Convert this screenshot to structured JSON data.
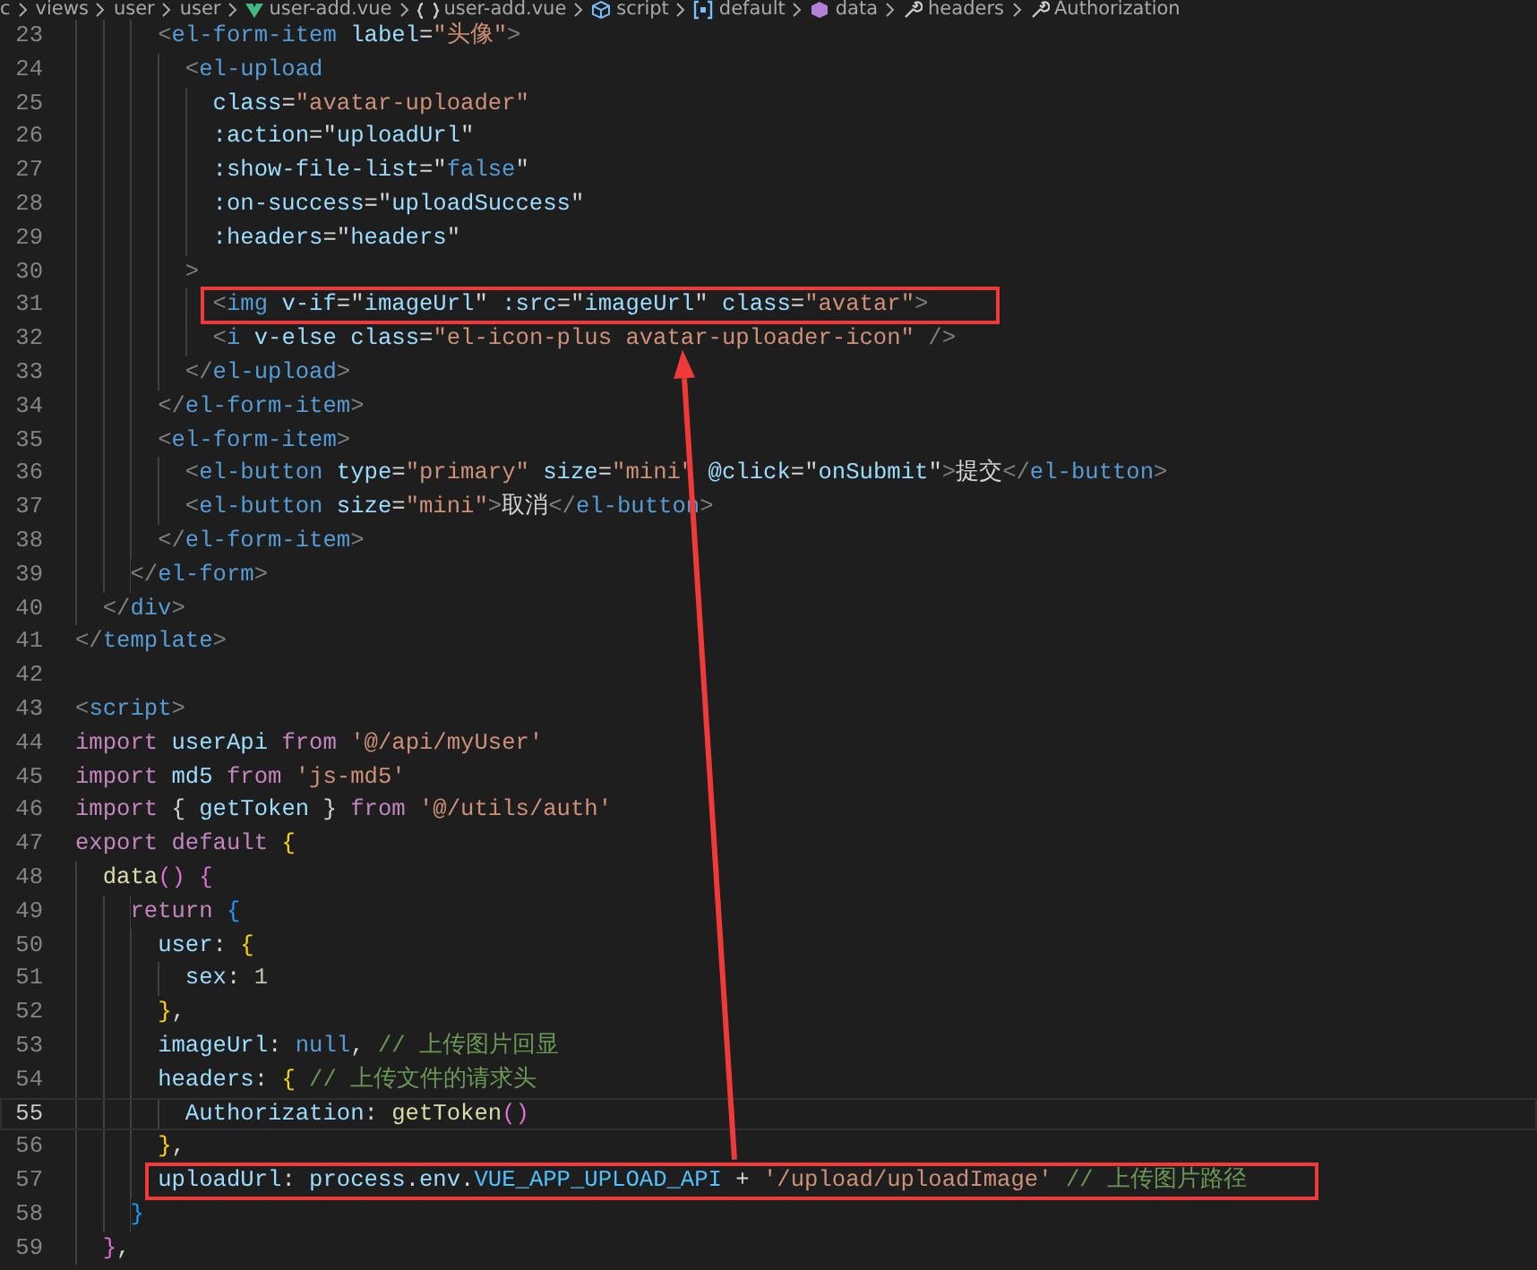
{
  "breadcrumb": [
    {
      "label": "c",
      "kind": "folder"
    },
    {
      "label": "views",
      "kind": "folder"
    },
    {
      "label": "user",
      "kind": "folder"
    },
    {
      "label": "user",
      "kind": "folder"
    },
    {
      "label": "user-add.vue",
      "kind": "vue-file"
    },
    {
      "label": "user-add.vue",
      "kind": "file-symbol"
    },
    {
      "label": "script",
      "kind": "module"
    },
    {
      "label": "default",
      "kind": "object"
    },
    {
      "label": "data",
      "kind": "method"
    },
    {
      "label": "headers",
      "kind": "property"
    },
    {
      "label": "Authorization",
      "kind": "property"
    }
  ],
  "editor": {
    "lines": [
      {
        "children": [
          {
            "children": [
              {
                "children": [
                  {
                    "number": "23",
                    "current": false,
                    "boxed": false,
                    "tokens": [
                      {
                        "kind": "p",
                        "text": "<"
                      },
                      {
                        "kind": "tag",
                        "text": "el-form-item"
                      },
                      {
                        "kind": "attr",
                        "text": " label"
                      },
                      {
                        "kind": "txt",
                        "text": "="
                      },
                      {
                        "kind": "str",
                        "text": "\"头像\""
                      },
                      {
                        "kind": "p",
                        "text": ">"
                      }
                    ],
                    "children": [
                      {
                        "number": "24",
                        "current": false,
                        "boxed": false,
                        "tokens": [
                          {
                            "kind": "p",
                            "text": "<"
                          },
                          {
                            "kind": "tag",
                            "text": "el-upload"
                          }
                        ],
                        "children": [
                          {
                            "number": "25",
                            "current": false,
                            "boxed": false,
                            "tokens": [
                              {
                                "kind": "attr",
                                "text": "class"
                              },
                              {
                                "kind": "txt",
                                "text": "="
                              },
                              {
                                "kind": "str",
                                "text": "\"avatar-uploader\""
                              }
                            ]
                          },
                          {
                            "number": "26",
                            "current": false,
                            "boxed": false,
                            "tokens": [
                              {
                                "kind": "attr",
                                "text": ":action"
                              },
                              {
                                "kind": "txt",
                                "text": "=\""
                              },
                              {
                                "kind": "var",
                                "text": "uploadUrl"
                              },
                              {
                                "kind": "txt",
                                "text": "\""
                              }
                            ]
                          },
                          {
                            "number": "27",
                            "current": false,
                            "boxed": false,
                            "tokens": [
                              {
                                "kind": "attr",
                                "text": ":show-file-list"
                              },
                              {
                                "kind": "txt",
                                "text": "=\""
                              },
                              {
                                "kind": "lit",
                                "text": "false"
                              },
                              {
                                "kind": "txt",
                                "text": "\""
                              }
                            ]
                          },
                          {
                            "number": "28",
                            "current": false,
                            "boxed": false,
                            "tokens": [
                              {
                                "kind": "attr",
                                "text": ":on-success"
                              },
                              {
                                "kind": "txt",
                                "text": "=\""
                              },
                              {
                                "kind": "var",
                                "text": "uploadSuccess"
                              },
                              {
                                "kind": "txt",
                                "text": "\""
                              }
                            ]
                          },
                          {
                            "number": "29",
                            "current": false,
                            "boxed": false,
                            "tokens": [
                              {
                                "kind": "attr",
                                "text": ":headers"
                              },
                              {
                                "kind": "txt",
                                "text": "=\""
                              },
                              {
                                "kind": "var",
                                "text": "headers"
                              },
                              {
                                "kind": "txt",
                                "text": "\""
                              }
                            ]
                          }
                        ]
                      },
                      {
                        "number": "30",
                        "current": false,
                        "boxed": false,
                        "tokens": [
                          {
                            "kind": "p",
                            "text": ">"
                          }
                        ],
                        "children": [
                          {
                            "number": "31",
                            "current": false,
                            "boxed": true,
                            "tokens": [
                              {
                                "kind": "p",
                                "text": "<"
                              },
                              {
                                "kind": "tag",
                                "text": "img"
                              },
                              {
                                "kind": "attr",
                                "text": " v-if"
                              },
                              {
                                "kind": "txt",
                                "text": "=\""
                              },
                              {
                                "kind": "var",
                                "text": "imageUrl"
                              },
                              {
                                "kind": "txt",
                                "text": "\""
                              },
                              {
                                "kind": "attr",
                                "text": " :src"
                              },
                              {
                                "kind": "txt",
                                "text": "=\""
                              },
                              {
                                "kind": "var",
                                "text": "imageUrl"
                              },
                              {
                                "kind": "txt",
                                "text": "\""
                              },
                              {
                                "kind": "attr",
                                "text": " class"
                              },
                              {
                                "kind": "txt",
                                "text": "="
                              },
                              {
                                "kind": "str",
                                "text": "\"avatar\""
                              },
                              {
                                "kind": "p",
                                "text": ">"
                              }
                            ]
                          },
                          {
                            "number": "32",
                            "current": false,
                            "boxed": false,
                            "tokens": [
                              {
                                "kind": "p",
                                "text": "<"
                              },
                              {
                                "kind": "tag",
                                "text": "i"
                              },
                              {
                                "kind": "attr",
                                "text": " v-else"
                              },
                              {
                                "kind": "attr",
                                "text": " class"
                              },
                              {
                                "kind": "txt",
                                "text": "="
                              },
                              {
                                "kind": "str",
                                "text": "\"el-icon-plus avatar-uploader-icon\""
                              },
                              {
                                "kind": "p",
                                "text": " />"
                              }
                            ]
                          }
                        ]
                      },
                      {
                        "number": "33",
                        "current": false,
                        "boxed": false,
                        "tokens": [
                          {
                            "kind": "p",
                            "text": "</"
                          },
                          {
                            "kind": "tag",
                            "text": "el-upload"
                          },
                          {
                            "kind": "p",
                            "text": ">"
                          }
                        ]
                      }
                    ]
                  },
                  {
                    "number": "34",
                    "current": false,
                    "boxed": false,
                    "tokens": [
                      {
                        "kind": "p",
                        "text": "</"
                      },
                      {
                        "kind": "tag",
                        "text": "el-form-item"
                      },
                      {
                        "kind": "p",
                        "text": ">"
                      }
                    ]
                  },
                  {
                    "number": "35",
                    "current": false,
                    "boxed": false,
                    "tokens": [
                      {
                        "kind": "p",
                        "text": "<"
                      },
                      {
                        "kind": "tag",
                        "text": "el-form-item"
                      },
                      {
                        "kind": "p",
                        "text": ">"
                      }
                    ],
                    "children": [
                      {
                        "number": "36",
                        "current": false,
                        "boxed": false,
                        "tokens": [
                          {
                            "kind": "p",
                            "text": "<"
                          },
                          {
                            "kind": "tag",
                            "text": "el-button"
                          },
                          {
                            "kind": "attr",
                            "text": " type"
                          },
                          {
                            "kind": "txt",
                            "text": "="
                          },
                          {
                            "kind": "str",
                            "text": "\"primary\""
                          },
                          {
                            "kind": "attr",
                            "text": " size"
                          },
                          {
                            "kind": "txt",
                            "text": "="
                          },
                          {
                            "kind": "str",
                            "text": "\"mini\""
                          },
                          {
                            "kind": "attr",
                            "text": " @click"
                          },
                          {
                            "kind": "txt",
                            "text": "=\""
                          },
                          {
                            "kind": "var",
                            "text": "onSubmit"
                          },
                          {
                            "kind": "txt",
                            "text": "\""
                          },
                          {
                            "kind": "p",
                            "text": ">"
                          },
                          {
                            "kind": "txt",
                            "text": "提交"
                          },
                          {
                            "kind": "p",
                            "text": "</"
                          },
                          {
                            "kind": "tag",
                            "text": "el-button"
                          },
                          {
                            "kind": "p",
                            "text": ">"
                          }
                        ]
                      },
                      {
                        "number": "37",
                        "current": false,
                        "boxed": false,
                        "tokens": [
                          {
                            "kind": "p",
                            "text": "<"
                          },
                          {
                            "kind": "tag",
                            "text": "el-button"
                          },
                          {
                            "kind": "attr",
                            "text": " size"
                          },
                          {
                            "kind": "txt",
                            "text": "="
                          },
                          {
                            "kind": "str",
                            "text": "\"mini\""
                          },
                          {
                            "kind": "p",
                            "text": ">"
                          },
                          {
                            "kind": "txt",
                            "text": "取消"
                          },
                          {
                            "kind": "p",
                            "text": "</"
                          },
                          {
                            "kind": "tag",
                            "text": "el-button"
                          },
                          {
                            "kind": "p",
                            "text": ">"
                          }
                        ]
                      }
                    ]
                  },
                  {
                    "number": "38",
                    "current": false,
                    "boxed": false,
                    "tokens": [
                      {
                        "kind": "p",
                        "text": "</"
                      },
                      {
                        "kind": "tag",
                        "text": "el-form-item"
                      },
                      {
                        "kind": "p",
                        "text": ">"
                      }
                    ]
                  }
                ]
              },
              {
                "number": "39",
                "current": false,
                "boxed": false,
                "tokens": [
                  {
                    "kind": "p",
                    "text": "</"
                  },
                  {
                    "kind": "tag",
                    "text": "el-form"
                  },
                  {
                    "kind": "p",
                    "text": ">"
                  }
                ]
              }
            ]
          },
          {
            "number": "40",
            "current": false,
            "boxed": false,
            "tokens": [
              {
                "kind": "p",
                "text": "</"
              },
              {
                "kind": "tag",
                "text": "div"
              },
              {
                "kind": "p",
                "text": ">"
              }
            ]
          }
        ]
      },
      {
        "number": "41",
        "current": false,
        "boxed": false,
        "tokens": [
          {
            "kind": "p",
            "text": "</"
          },
          {
            "kind": "tag",
            "text": "template"
          },
          {
            "kind": "p",
            "text": ">"
          }
        ]
      },
      {
        "number": "42",
        "current": false,
        "boxed": false
      },
      {
        "number": "43",
        "current": false,
        "boxed": false,
        "tokens": [
          {
            "kind": "p",
            "text": "<"
          },
          {
            "kind": "tag",
            "text": "script"
          },
          {
            "kind": "p",
            "text": ">"
          }
        ]
      },
      {
        "number": "44",
        "current": false,
        "boxed": false,
        "tokens": [
          {
            "kind": "kw",
            "text": "import"
          },
          {
            "kind": "var",
            "text": " userApi"
          },
          {
            "kind": "kw",
            "text": " from"
          },
          {
            "kind": "str",
            "text": " '@/api/myUser'"
          }
        ]
      },
      {
        "number": "45",
        "current": false,
        "boxed": false,
        "tokens": [
          {
            "kind": "kw",
            "text": "import"
          },
          {
            "kind": "var",
            "text": " md5"
          },
          {
            "kind": "kw",
            "text": " from"
          },
          {
            "kind": "str",
            "text": " 'js-md5'"
          }
        ]
      },
      {
        "number": "46",
        "current": false,
        "boxed": false,
        "tokens": [
          {
            "kind": "kw",
            "text": "import"
          },
          {
            "kind": "txt",
            "text": " {"
          },
          {
            "kind": "var",
            "text": " getToken"
          },
          {
            "kind": "txt",
            "text": " }"
          },
          {
            "kind": "kw",
            "text": " from"
          },
          {
            "kind": "str",
            "text": " '@/utils/auth'"
          }
        ]
      },
      {
        "number": "47",
        "current": false,
        "boxed": false,
        "tokens": [
          {
            "kind": "kw",
            "text": "export"
          },
          {
            "kind": "kw",
            "text": " default"
          },
          {
            "kind": "b1",
            "text": " {"
          }
        ],
        "children": [
          {
            "number": "48",
            "current": false,
            "boxed": false,
            "tokens": [
              {
                "kind": "fn",
                "text": "data"
              },
              {
                "kind": "b2",
                "text": "()"
              },
              {
                "kind": "b2",
                "text": " {"
              }
            ],
            "children": [
              {
                "number": "49",
                "current": false,
                "boxed": false,
                "tokens": [
                  {
                    "kind": "kw",
                    "text": "return"
                  },
                  {
                    "kind": "b3",
                    "text": " {"
                  }
                ],
                "children": [
                  {
                    "number": "50",
                    "current": false,
                    "boxed": false,
                    "tokens": [
                      {
                        "kind": "var",
                        "text": "user"
                      },
                      {
                        "kind": "txt",
                        "text": ":"
                      },
                      {
                        "kind": "b1",
                        "text": " {"
                      }
                    ],
                    "children": [
                      {
                        "number": "51",
                        "current": false,
                        "boxed": false,
                        "tokens": [
                          {
                            "kind": "var",
                            "text": "sex"
                          },
                          {
                            "kind": "txt",
                            "text": ":"
                          },
                          {
                            "kind": "num",
                            "text": " 1"
                          }
                        ]
                      }
                    ]
                  },
                  {
                    "number": "52",
                    "current": false,
                    "boxed": false,
                    "tokens": [
                      {
                        "kind": "b1",
                        "text": "}"
                      },
                      {
                        "kind": "txt",
                        "text": ","
                      }
                    ]
                  },
                  {
                    "number": "53",
                    "current": false,
                    "boxed": false,
                    "tokens": [
                      {
                        "kind": "var",
                        "text": "imageUrl"
                      },
                      {
                        "kind": "txt",
                        "text": ":"
                      },
                      {
                        "kind": "lit",
                        "text": " null"
                      },
                      {
                        "kind": "txt",
                        "text": ","
                      },
                      {
                        "kind": "cmt",
                        "text": " // 上传图片回显"
                      }
                    ]
                  },
                  {
                    "number": "54",
                    "current": false,
                    "boxed": false,
                    "tokens": [
                      {
                        "kind": "var",
                        "text": "headers"
                      },
                      {
                        "kind": "txt",
                        "text": ":"
                      },
                      {
                        "kind": "b1",
                        "text": " {"
                      },
                      {
                        "kind": "cmt",
                        "text": " // 上传文件的请求头"
                      }
                    ],
                    "children": [
                      {
                        "number": "55",
                        "current": true,
                        "boxed": false,
                        "tokens": [
                          {
                            "kind": "var",
                            "text": "Authorization"
                          },
                          {
                            "kind": "txt",
                            "text": ":"
                          },
                          {
                            "kind": "fn",
                            "text": " getToken"
                          },
                          {
                            "kind": "b2",
                            "text": "()"
                          }
                        ]
                      }
                    ]
                  },
                  {
                    "number": "56",
                    "current": false,
                    "boxed": false,
                    "arrow": true,
                    "tokens": [
                      {
                        "kind": "b1",
                        "text": "}"
                      },
                      {
                        "kind": "txt",
                        "text": ","
                      }
                    ]
                  },
                  {
                    "number": "57",
                    "current": false,
                    "boxed": true,
                    "tokens": [
                      {
                        "kind": "var",
                        "text": "uploadUrl"
                      },
                      {
                        "kind": "txt",
                        "text": ":"
                      },
                      {
                        "kind": "var",
                        "text": " process"
                      },
                      {
                        "kind": "txt",
                        "text": "."
                      },
                      {
                        "kind": "var",
                        "text": "env"
                      },
                      {
                        "kind": "txt",
                        "text": "."
                      },
                      {
                        "kind": "const",
                        "text": "VUE_APP_UPLOAD_API"
                      },
                      {
                        "kind": "txt",
                        "text": " +"
                      },
                      {
                        "kind": "str",
                        "text": " '/upload/uploadImage'"
                      },
                      {
                        "kind": "cmt",
                        "text": " // 上传图片路径"
                      }
                    ]
                  }
                ]
              },
              {
                "number": "58",
                "current": false,
                "boxed": false,
                "tokens": [
                  {
                    "kind": "b3",
                    "text": "}"
                  }
                ]
              }
            ]
          },
          {
            "number": "59",
            "current": false,
            "boxed": false,
            "tokens": [
              {
                "kind": "b2",
                "text": "}"
              },
              {
                "kind": "txt",
                "text": ","
              }
            ]
          }
        ]
      }
    ]
  }
}
